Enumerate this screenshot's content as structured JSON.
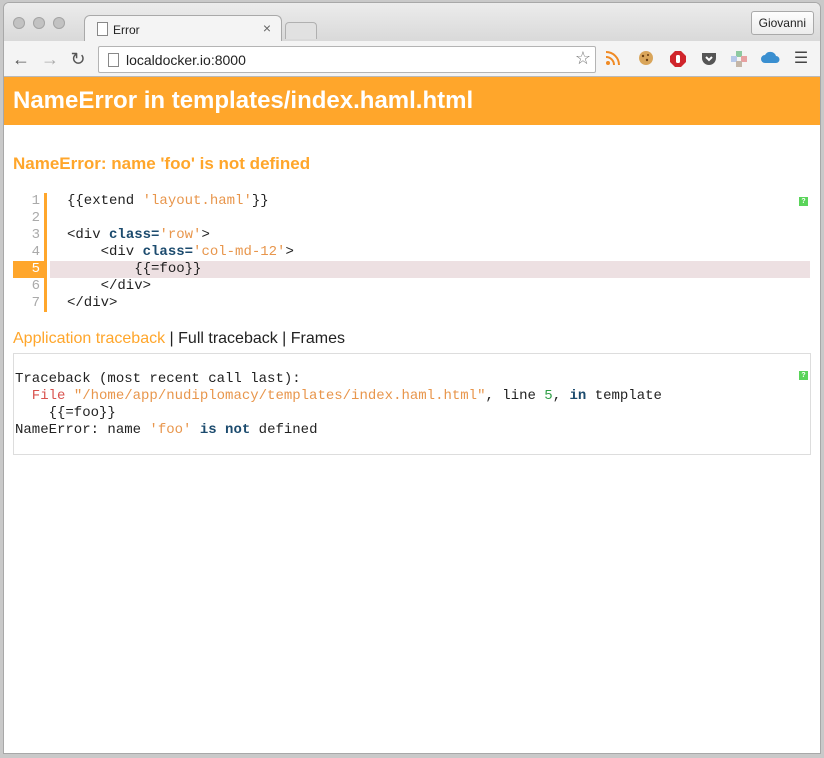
{
  "browser": {
    "tab_title": "Error",
    "profile_name": "Giovanni",
    "url": "localdocker.io:8000"
  },
  "page": {
    "header_title": "NameError in templates/index.haml.html",
    "error_message": "NameError: name 'foo' is not defined",
    "code_lines": [
      {
        "num": "1",
        "parts": [
          {
            "t": "{{extend ",
            "c": ""
          },
          {
            "t": "'layout.haml'",
            "c": "str"
          },
          {
            "t": "}}",
            "c": ""
          }
        ]
      },
      {
        "num": "2",
        "parts": []
      },
      {
        "num": "3",
        "parts": [
          {
            "t": "<div ",
            "c": ""
          },
          {
            "t": "class=",
            "c": "kw"
          },
          {
            "t": "'row'",
            "c": "str"
          },
          {
            "t": ">",
            "c": ""
          }
        ]
      },
      {
        "num": "4",
        "parts": [
          {
            "t": "    <div ",
            "c": ""
          },
          {
            "t": "class=",
            "c": "kw"
          },
          {
            "t": "'col-md-12'",
            "c": "str"
          },
          {
            "t": ">",
            "c": ""
          }
        ]
      },
      {
        "num": "5",
        "parts": [
          {
            "t": "        {{=foo}}",
            "c": ""
          }
        ],
        "error": true
      },
      {
        "num": "6",
        "parts": [
          {
            "t": "    </div>",
            "c": ""
          }
        ]
      },
      {
        "num": "7",
        "parts": [
          {
            "t": "</div>",
            "c": ""
          }
        ]
      }
    ],
    "traceback_tabs": [
      {
        "label": "Application traceback",
        "active": true
      },
      {
        "label": "Full traceback",
        "active": false
      },
      {
        "label": "Frames",
        "active": false
      }
    ],
    "traceback_lines": [
      [
        {
          "t": "Traceback (most recent call last):",
          "c": ""
        }
      ],
      [
        {
          "t": "  File ",
          "c": "tb-file"
        },
        {
          "t": "\"/home/app/nudiplomacy/templates/index.haml.html\"",
          "c": "str"
        },
        {
          "t": ", line ",
          "c": ""
        },
        {
          "t": "5",
          "c": "num"
        },
        {
          "t": ", ",
          "c": ""
        },
        {
          "t": "in",
          "c": "kw"
        },
        {
          "t": " template",
          "c": ""
        }
      ],
      [
        {
          "t": "    {{=foo}}",
          "c": ""
        }
      ],
      [
        {
          "t": "NameError: name ",
          "c": ""
        },
        {
          "t": "'foo'",
          "c": "str"
        },
        {
          "t": " ",
          "c": ""
        },
        {
          "t": "is not",
          "c": "kw"
        },
        {
          "t": " defined",
          "c": ""
        }
      ]
    ]
  },
  "icons": {
    "back": "back-arrow-icon",
    "forward": "forward-arrow-icon",
    "reload": "reload-icon",
    "bookmark": "star-icon",
    "extensions": [
      "rss-icon",
      "cookie-icon",
      "adblock-icon",
      "pocket-icon",
      "puzzle-icon",
      "cloud-icon",
      "menu-icon"
    ]
  },
  "colors": {
    "accent": "#ffa62b",
    "highlight_row": "#ede0e2"
  }
}
